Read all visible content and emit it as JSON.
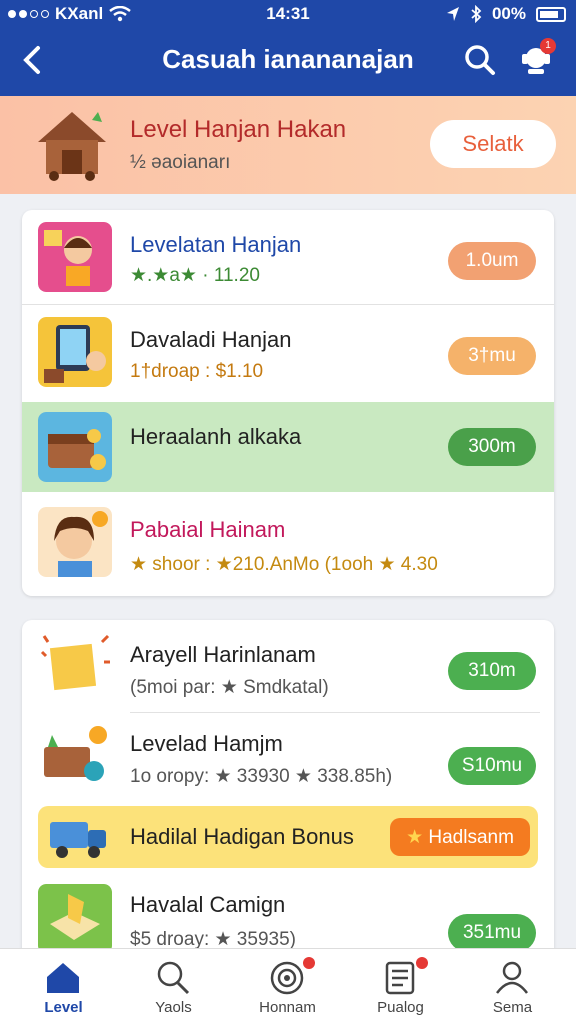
{
  "status_bar": {
    "carrier": "KXanl",
    "time": "14:31",
    "battery": "00%"
  },
  "header": {
    "title": "Casuah ianananajan",
    "notification_count": "1"
  },
  "banner": {
    "title": "Level Hanjan Hakan",
    "subtitle": "½ ǝaoianarı",
    "button": "Selatk"
  },
  "list_a": [
    {
      "name": "Levelatan Hanjan",
      "meta": "★.★a★ · 11.20",
      "pill": "1.0um",
      "color": "#f2a172",
      "name_color": "#1f48a8",
      "meta_color": "#3c8a34",
      "highlight": false
    },
    {
      "name": "Davaladi Hanjan",
      "meta": "1†droap : $1.10",
      "pill": "3†mu",
      "color": "#f5b26a",
      "name_color": "#222222",
      "meta_color": "#c47a10",
      "highlight": false
    },
    {
      "name": "Heraalanh alkaka",
      "meta": "",
      "pill": "300m",
      "color": "#4aa04a",
      "name_color": "#222222",
      "meta_color": "#555555",
      "highlight": true
    },
    {
      "name": "Pabaial Hainam",
      "meta": "★ shoor : ★210.AnMo  (1ooh ★ 4.30",
      "pill": "",
      "color": "#ffffff",
      "name_color": "#c2185b",
      "meta_color": "#c48a10",
      "highlight": false
    }
  ],
  "list_b": [
    {
      "name": "Arayell Harinlanam",
      "meta": "(5moi par: ★ Smdkatal)",
      "pill": "310m",
      "color": "#4caf50"
    },
    {
      "name": "Levelad Hamjm",
      "meta": "1o oropy: ★ 33930 ★ 338.85h)",
      "pill": "S10mu",
      "color": "#4caf50"
    },
    {
      "name": "Havalal Camign",
      "meta": "$5 droay: ★ 35935)",
      "pill": "351mu",
      "color": "#4caf50"
    }
  ],
  "bonus": {
    "label": "Hadilal Hadigan Bonus",
    "button": "Hadlsanm"
  },
  "nav": [
    {
      "label": "Level",
      "icon": "home-icon"
    },
    {
      "label": "Yaols",
      "icon": "search-icon"
    },
    {
      "label": "Honnam",
      "icon": "target-icon"
    },
    {
      "label": "Pualog",
      "icon": "list-icon"
    },
    {
      "label": "Sema",
      "icon": "profile-icon"
    }
  ],
  "colors": {
    "brand": "#1f48a8",
    "accent": "#e8603c",
    "green": "#4caf50"
  }
}
